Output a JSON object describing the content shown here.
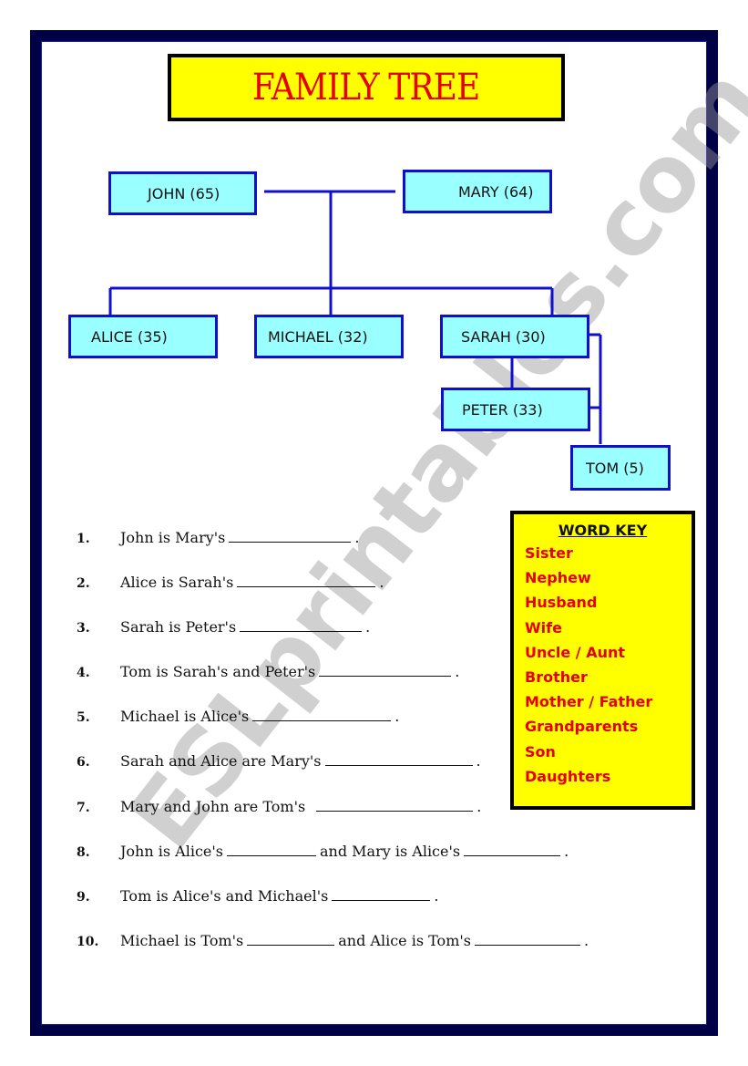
{
  "title": "FAMILY TREE",
  "watermark": "ESLprintables.com",
  "tree": {
    "nodes": [
      {
        "id": "john",
        "label": "JOHN (65)"
      },
      {
        "id": "mary",
        "label": "MARY (64)"
      },
      {
        "id": "alice",
        "label": "ALICE (35)"
      },
      {
        "id": "michael",
        "label": "MICHAEL (32)"
      },
      {
        "id": "sarah",
        "label": "SARAH (30)"
      },
      {
        "id": "peter",
        "label": "PETER (33)"
      },
      {
        "id": "tom",
        "label": "TOM (5)"
      }
    ]
  },
  "word_key": {
    "title": "WORD KEY",
    "items": [
      "Sister",
      "Nephew",
      "Husband",
      "Wife",
      "Uncle / Aunt",
      "Brother",
      "Mother / Father",
      "Grandparents",
      "Son",
      "Daughters"
    ]
  },
  "questions": [
    {
      "num": "1.",
      "parts": [
        "John is Mary's",
        "."
      ]
    },
    {
      "num": "2.",
      "parts": [
        "Alice is Sarah's",
        "."
      ]
    },
    {
      "num": "3.",
      "parts": [
        "Sarah is Peter's",
        "."
      ]
    },
    {
      "num": "4.",
      "parts": [
        "Tom is Sarah's and Peter's",
        "."
      ]
    },
    {
      "num": "5.",
      "parts": [
        "Michael is Alice's",
        "."
      ]
    },
    {
      "num": "6.",
      "parts": [
        "Sarah and Alice are Mary's",
        "."
      ]
    },
    {
      "num": "7.",
      "parts": [
        "Mary and John are Tom's",
        "."
      ]
    },
    {
      "num": "8.",
      "parts": [
        "John is Alice's",
        "and Mary is Alice's",
        "."
      ]
    },
    {
      "num": "9.",
      "parts": [
        "Tom is Alice's and Michael's",
        "."
      ]
    },
    {
      "num": "10.",
      "parts": [
        "Michael is Tom's",
        "and Alice is Tom's",
        "."
      ]
    }
  ]
}
